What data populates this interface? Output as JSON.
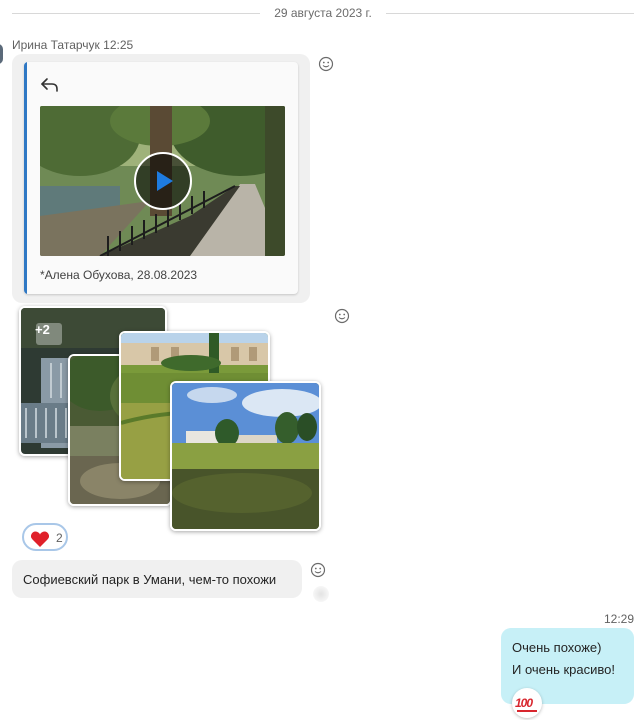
{
  "date_separator": "29 августа 2023 г.",
  "message1": {
    "sender": "Ирина Татарчук",
    "time": "12:25",
    "quoted": {
      "caption": "*Алена Обухова, 28.08.2023",
      "icon": "forward-arrow-icon",
      "media": "video",
      "play_icon": "play-icon"
    }
  },
  "message2": {
    "extra_photos_badge": "+2",
    "photo_count_shown": 4,
    "reaction": {
      "emoji": "heart",
      "count": "2"
    }
  },
  "message3": {
    "text": "Софиевский парк в Умани, чем-то похожи"
  },
  "reply": {
    "time": "12:29",
    "lines": [
      "Очень похоже)",
      "И очень красиво!"
    ],
    "reaction": {
      "emoji": "100"
    }
  },
  "colors": {
    "accent_blue": "#2f78c4",
    "incoming_bubble": "#f0f0f0",
    "outgoing_bubble": "#c7f0f7",
    "heart": "#e0202a"
  }
}
